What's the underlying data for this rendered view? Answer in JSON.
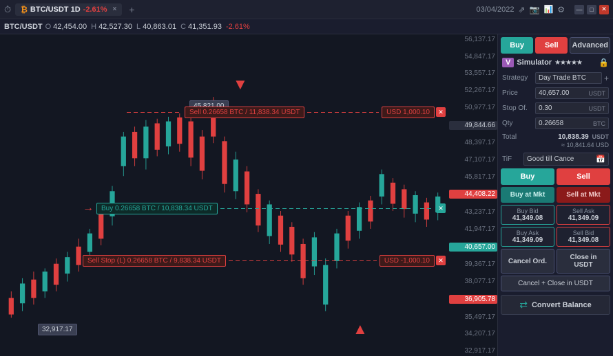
{
  "topbar": {
    "clock_icon": "⏱",
    "symbol_icon": "₿",
    "pair": "BTC/USDT 1D",
    "change": "-2.61%",
    "date": "03/04/2022",
    "tab_close": "×",
    "add_tab": "+",
    "icons": [
      "share",
      "camera",
      "chart",
      "settings",
      "minimize",
      "maximize",
      "close"
    ],
    "window": {
      "minimize": "—",
      "maximize": "□",
      "close": "✕"
    }
  },
  "ohlc": {
    "pair": "BTC/USDT",
    "o_label": "O",
    "o_val": "42,454.00",
    "h_label": "H",
    "h_val": "42,527.30",
    "l_label": "L",
    "l_val": "40,863.01",
    "c_label": "C",
    "c_val": "41,351.93",
    "change": "-2.61%"
  },
  "price_labels": [
    "56,137.17",
    "54,847.17",
    "53,557.17",
    "52,267.17",
    "50,977.17",
    "49,844.66",
    "48,397.17",
    "47,107.17",
    "45,817.17",
    "44,408.22",
    "43,237.17",
    "41,947.17",
    "40,657.00",
    "39,367.17",
    "38,077.17",
    "36,905.78",
    "35,497.17",
    "34,207.17",
    "32,917.17"
  ],
  "highlighted_prices": {
    "p49844": "49,844.66",
    "p44408": "44,408.22",
    "p40657": "40,657.00",
    "p36905": "36,905.78"
  },
  "price_boxes": {
    "box45821": "45,821.00",
    "box32917": "32,917.17"
  },
  "orders": {
    "sell_top": {
      "tag": "Sell 0.26658 BTC / 11,838.34 USDT",
      "usd": "USD 1,000.10",
      "price": "44,408.22"
    },
    "buy_mid": {
      "tag": "Buy 0.26658 BTC / 10,838.34 USDT",
      "price": "40,657.00"
    },
    "sell_bot": {
      "tag": "Sell Stop (L) 0.26658 BTC / 9,838.34 USDT",
      "usd": "USD -1,000.10",
      "price": "36,905.78"
    }
  },
  "right_panel": {
    "buy_label": "Buy",
    "sell_label": "Sell",
    "advanced_label": "Advanced",
    "sim_v": "V",
    "sim_name": "Simulator",
    "sim_stars": "★★★★★",
    "strategy_label": "Strategy",
    "strategy_val": "Day Trade BTC",
    "price_label": "Price",
    "price_val": "40,657.00",
    "price_unit": "USDT",
    "stop_label": "Stop Of.",
    "stop_val": "0.30",
    "stop_unit": "USDT",
    "qty_label": "Qty",
    "qty_val": "0.26658",
    "qty_unit": "BTC",
    "total_label": "Total",
    "total_val": "10,838.39",
    "total_unit": "USDT",
    "total_approx": "≈ 10,841.64 USD",
    "tif_label": "TiF",
    "tif_val": "Good till Cance",
    "buy_action": "Buy",
    "sell_action": "Sell",
    "buy_mkt": "Buy at Mkt",
    "sell_mkt": "Sell at Mkt",
    "buy_bid_label": "Buy Bid",
    "buy_bid_val": "41,349.08",
    "sell_ask_label": "Sell Ask",
    "sell_ask_val": "41,349.09",
    "buy_ask_label": "Buy Ask",
    "buy_ask_val": "41,349.09",
    "sell_bid_label": "Sell Bid",
    "sell_bid_val": "41,349.08",
    "cancel_label": "Cancel Ord.",
    "close_usdt_label": "Close in USDT",
    "cancel_close_label": "Cancel + Close in USDT",
    "convert_balance": "Convert Balance",
    "convert_icon": "⇄"
  }
}
